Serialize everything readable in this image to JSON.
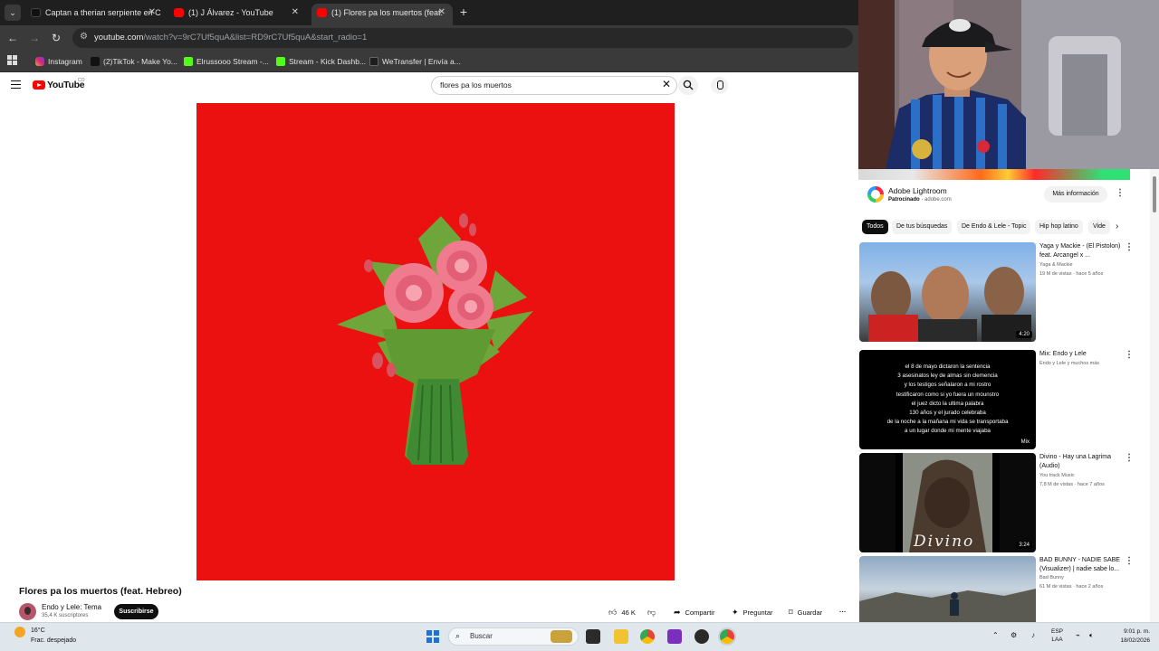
{
  "browser": {
    "tabs": [
      {
        "title": "Captan a therian serpiente en C",
        "active": false
      },
      {
        "title": "(1) J Álvarez - YouTube",
        "active": false
      },
      {
        "title": "(1) Flores pa los muertos (feat.",
        "active": true
      }
    ],
    "url_host": "youtube.com",
    "url_path": "/watch?v=9rC7Uf5quA&list=RD9rC7Uf5quA&start_radio=1",
    "bookmarks": [
      "Instagram",
      "(2)TikTok - Make Yo...",
      "Elrussooo Stream -...",
      "Stream - Kick Dashb...",
      "WeTransfer | Envía a..."
    ]
  },
  "youtube": {
    "logo_text": "YouTube",
    "country_code": "CO",
    "search_query": "flores pa los muertos",
    "video": {
      "title": "Flores pa los muertos (feat. Hebreo)",
      "channel": "Endo y Lele: Tema",
      "subscribers": "35,4 K suscriptores",
      "subscribe_label": "Suscribirse",
      "likes": "46 K",
      "share_label": "Compartir",
      "ask_label": "Preguntar",
      "save_label": "Guardar"
    },
    "ad": {
      "title": "Adobe Lightroom",
      "sponsored": "Patrocinado",
      "domain": "adobe.com",
      "more_info": "Más información"
    },
    "chips": [
      "Todos",
      "De tus búsquedas",
      "De Endo & Lele - Topic",
      "Hip hop latino",
      "Vide"
    ],
    "recommendations": [
      {
        "title": "Yaga y Mackie - (El Pistolon) feat. Arcangel x ...",
        "channel": "Yaga & Mackie",
        "meta": "19 M de vistas · hace 5 años",
        "duration": "4:20"
      },
      {
        "title": "Mix: Endo y Lele",
        "channel": "Endo y Lele y muchos más",
        "meta": "",
        "duration": "Mix",
        "thumb_lines": [
          "el 8 de mayo dictaron la sentencia",
          "3 asesinatos ley de almas sin clemencia",
          "y los testigos señalaron a mi rostro",
          "testificaron como si yo fuera un mounstro",
          "el juez dicto la ultima palabra",
          "130 años y el jurado celebraba",
          "de la noche a la mañana mi vida se transportaba",
          "a un lugar donde mi mente viajaba"
        ]
      },
      {
        "title": "Divino - Hay una Lagrima (Audio)",
        "channel": "You track Music",
        "meta": "7,8 M de vistas · hace 7 años",
        "duration": "3:24",
        "thumb_caption": "Divino"
      },
      {
        "title": "BAD BUNNY - NADIE SABE (Visualizer) | nadie sabe lo...",
        "channel": "Bad Bunny",
        "meta": "61 M de vistas · hace 2 años",
        "duration": ""
      }
    ]
  },
  "taskbar": {
    "temperature": "16°C",
    "weather": "Frac. despejado",
    "search_label": "Buscar",
    "lang_line1": "ESP",
    "lang_line2": "LAA",
    "time": "9:01 p. m.",
    "date": "18/02/2026"
  },
  "colors": {
    "video_background": "#eb1111",
    "youtube_red": "#ff0000",
    "rose_pink": "#f07a8e",
    "leaf_green": "#6fa63b",
    "taskbar": "#dfe7ec"
  },
  "icons": [
    "hamburger-icon",
    "youtube-logo-icon",
    "search-icon",
    "mic-icon",
    "close-icon",
    "like-icon",
    "dislike-icon",
    "share-icon",
    "ask-icon",
    "save-icon",
    "more-icon",
    "windows-icon"
  ]
}
